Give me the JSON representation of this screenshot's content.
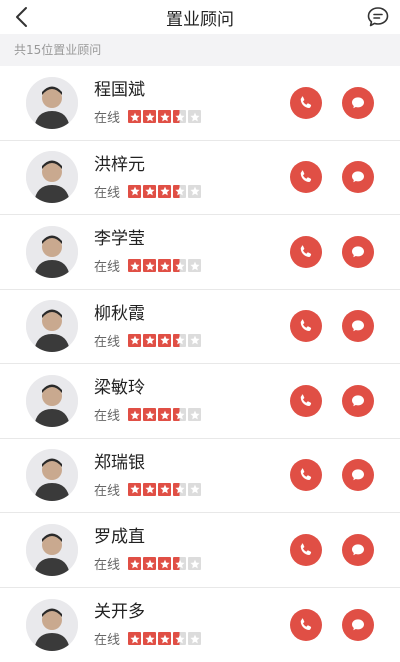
{
  "navbar": {
    "title": "置业顾问",
    "back_icon": "back-chevron-icon",
    "message_icon": "message-bubble-icon"
  },
  "summary": {
    "text": "共15位置业顾问"
  },
  "colors": {
    "accent": "#e04f45",
    "star_empty": "#dcdcdc",
    "divider": "#e8e8e8",
    "summary_bg": "#f3f3f5"
  },
  "advisors": [
    {
      "name": "程国斌",
      "status": "在线",
      "rating": 3.5
    },
    {
      "name": "洪梓元",
      "status": "在线",
      "rating": 3.5
    },
    {
      "name": "李学莹",
      "status": "在线",
      "rating": 3.5
    },
    {
      "name": "柳秋霞",
      "status": "在线",
      "rating": 3.5
    },
    {
      "name": "梁敏玲",
      "status": "在线",
      "rating": 3.5
    },
    {
      "name": "郑瑞银",
      "status": "在线",
      "rating": 3.5
    },
    {
      "name": "罗成直",
      "status": "在线",
      "rating": 3.5
    },
    {
      "name": "关开多",
      "status": "在线",
      "rating": 3.5
    }
  ]
}
